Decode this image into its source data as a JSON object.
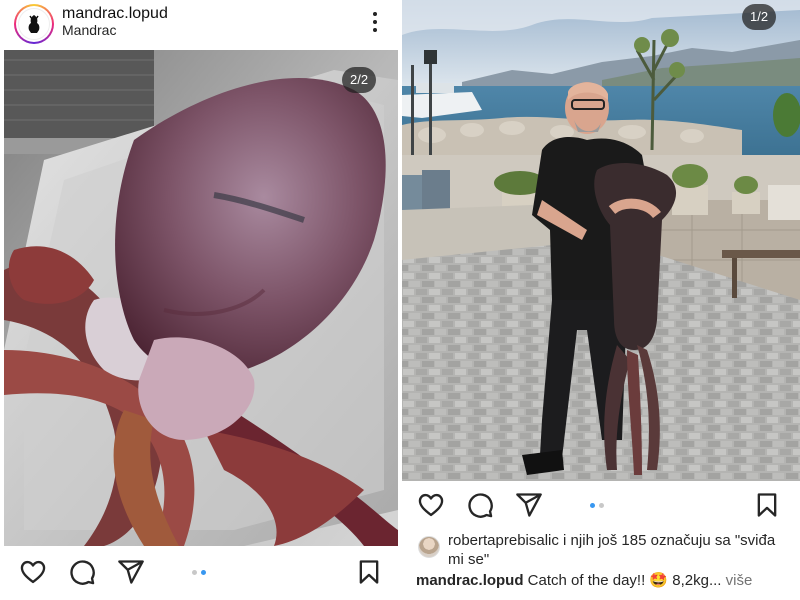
{
  "left_post": {
    "username": "mandrac.lopud",
    "subtitle": "Mandrac",
    "counter": "2/2",
    "carousel_dots": [
      false,
      true
    ],
    "icons": {
      "menu": "more-vertical-icon",
      "like": "heart-icon",
      "comment": "comment-icon",
      "share": "send-icon",
      "save": "bookmark-icon",
      "avatar": "mandrac-logo-icon"
    }
  },
  "right_post": {
    "counter": "1/2",
    "carousel_dots": [
      true,
      false
    ],
    "likes": {
      "user": "robertaprebisalic",
      "rest": " i njih još 185 označuju sa \"sviđa mi se\""
    },
    "caption": {
      "user": "mandrac.lopud",
      "text": " Catch of the day!! 🤩 8,2kg",
      "ellipsis": "...",
      "more": " više"
    }
  },
  "colors": {
    "dot_active": "#3897f0",
    "dot_inactive": "#c8c8c8",
    "text": "#262626",
    "muted": "#737373"
  }
}
